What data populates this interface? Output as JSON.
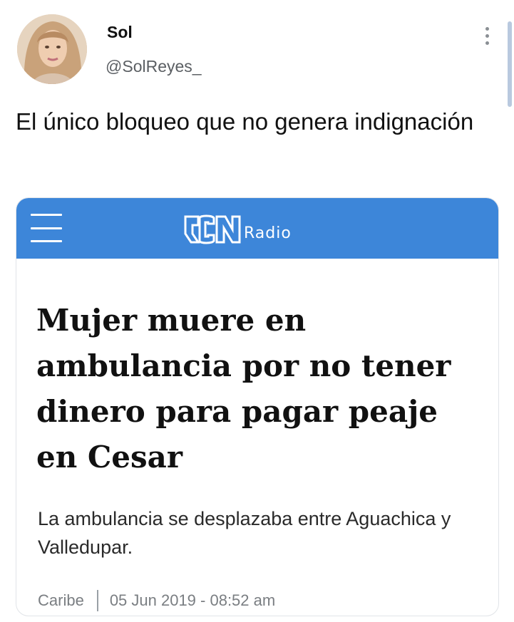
{
  "tweet": {
    "display_name": "Sol",
    "handle": "@SolReyes_",
    "text": "El único bloqueo que no genera indignación",
    "avatar_icon": "avatar-photo",
    "more_icon": "vertical-ellipsis-icon"
  },
  "card": {
    "brand": {
      "logo_text": "RCN",
      "radio_label": "Radio",
      "bar_color": "#3d86d9",
      "menu_icon": "hamburger-menu-icon"
    },
    "headline": "Mujer muere en ambulancia por no tener dinero para pagar peaje en Cesar",
    "subhead": "La ambulancia se desplazaba entre Aguachica y Valledupar.",
    "section": "Caribe",
    "date": "05 Jun 2019 - 08:52 am"
  }
}
